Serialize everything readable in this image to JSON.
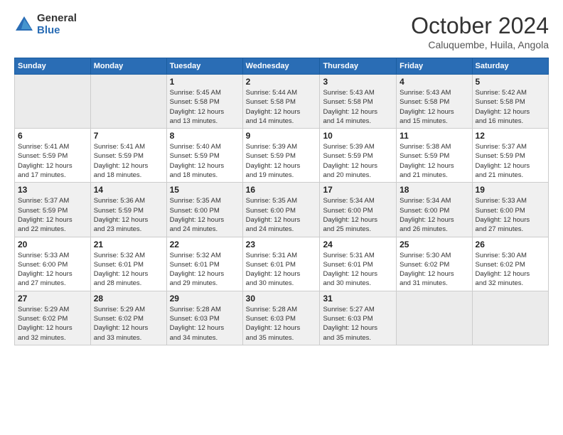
{
  "logo": {
    "general": "General",
    "blue": "Blue"
  },
  "title": {
    "month": "October 2024",
    "location": "Caluquembe, Huila, Angola"
  },
  "headers": [
    "Sunday",
    "Monday",
    "Tuesday",
    "Wednesday",
    "Thursday",
    "Friday",
    "Saturday"
  ],
  "weeks": [
    [
      {
        "day": "",
        "info": ""
      },
      {
        "day": "",
        "info": ""
      },
      {
        "day": "1",
        "info": "Sunrise: 5:45 AM\nSunset: 5:58 PM\nDaylight: 12 hours\nand 13 minutes."
      },
      {
        "day": "2",
        "info": "Sunrise: 5:44 AM\nSunset: 5:58 PM\nDaylight: 12 hours\nand 14 minutes."
      },
      {
        "day": "3",
        "info": "Sunrise: 5:43 AM\nSunset: 5:58 PM\nDaylight: 12 hours\nand 14 minutes."
      },
      {
        "day": "4",
        "info": "Sunrise: 5:43 AM\nSunset: 5:58 PM\nDaylight: 12 hours\nand 15 minutes."
      },
      {
        "day": "5",
        "info": "Sunrise: 5:42 AM\nSunset: 5:58 PM\nDaylight: 12 hours\nand 16 minutes."
      }
    ],
    [
      {
        "day": "6",
        "info": "Sunrise: 5:41 AM\nSunset: 5:59 PM\nDaylight: 12 hours\nand 17 minutes."
      },
      {
        "day": "7",
        "info": "Sunrise: 5:41 AM\nSunset: 5:59 PM\nDaylight: 12 hours\nand 18 minutes."
      },
      {
        "day": "8",
        "info": "Sunrise: 5:40 AM\nSunset: 5:59 PM\nDaylight: 12 hours\nand 18 minutes."
      },
      {
        "day": "9",
        "info": "Sunrise: 5:39 AM\nSunset: 5:59 PM\nDaylight: 12 hours\nand 19 minutes."
      },
      {
        "day": "10",
        "info": "Sunrise: 5:39 AM\nSunset: 5:59 PM\nDaylight: 12 hours\nand 20 minutes."
      },
      {
        "day": "11",
        "info": "Sunrise: 5:38 AM\nSunset: 5:59 PM\nDaylight: 12 hours\nand 21 minutes."
      },
      {
        "day": "12",
        "info": "Sunrise: 5:37 AM\nSunset: 5:59 PM\nDaylight: 12 hours\nand 21 minutes."
      }
    ],
    [
      {
        "day": "13",
        "info": "Sunrise: 5:37 AM\nSunset: 5:59 PM\nDaylight: 12 hours\nand 22 minutes."
      },
      {
        "day": "14",
        "info": "Sunrise: 5:36 AM\nSunset: 5:59 PM\nDaylight: 12 hours\nand 23 minutes."
      },
      {
        "day": "15",
        "info": "Sunrise: 5:35 AM\nSunset: 6:00 PM\nDaylight: 12 hours\nand 24 minutes."
      },
      {
        "day": "16",
        "info": "Sunrise: 5:35 AM\nSunset: 6:00 PM\nDaylight: 12 hours\nand 24 minutes."
      },
      {
        "day": "17",
        "info": "Sunrise: 5:34 AM\nSunset: 6:00 PM\nDaylight: 12 hours\nand 25 minutes."
      },
      {
        "day": "18",
        "info": "Sunrise: 5:34 AM\nSunset: 6:00 PM\nDaylight: 12 hours\nand 26 minutes."
      },
      {
        "day": "19",
        "info": "Sunrise: 5:33 AM\nSunset: 6:00 PM\nDaylight: 12 hours\nand 27 minutes."
      }
    ],
    [
      {
        "day": "20",
        "info": "Sunrise: 5:33 AM\nSunset: 6:00 PM\nDaylight: 12 hours\nand 27 minutes."
      },
      {
        "day": "21",
        "info": "Sunrise: 5:32 AM\nSunset: 6:01 PM\nDaylight: 12 hours\nand 28 minutes."
      },
      {
        "day": "22",
        "info": "Sunrise: 5:32 AM\nSunset: 6:01 PM\nDaylight: 12 hours\nand 29 minutes."
      },
      {
        "day": "23",
        "info": "Sunrise: 5:31 AM\nSunset: 6:01 PM\nDaylight: 12 hours\nand 30 minutes."
      },
      {
        "day": "24",
        "info": "Sunrise: 5:31 AM\nSunset: 6:01 PM\nDaylight: 12 hours\nand 30 minutes."
      },
      {
        "day": "25",
        "info": "Sunrise: 5:30 AM\nSunset: 6:02 PM\nDaylight: 12 hours\nand 31 minutes."
      },
      {
        "day": "26",
        "info": "Sunrise: 5:30 AM\nSunset: 6:02 PM\nDaylight: 12 hours\nand 32 minutes."
      }
    ],
    [
      {
        "day": "27",
        "info": "Sunrise: 5:29 AM\nSunset: 6:02 PM\nDaylight: 12 hours\nand 32 minutes."
      },
      {
        "day": "28",
        "info": "Sunrise: 5:29 AM\nSunset: 6:02 PM\nDaylight: 12 hours\nand 33 minutes."
      },
      {
        "day": "29",
        "info": "Sunrise: 5:28 AM\nSunset: 6:03 PM\nDaylight: 12 hours\nand 34 minutes."
      },
      {
        "day": "30",
        "info": "Sunrise: 5:28 AM\nSunset: 6:03 PM\nDaylight: 12 hours\nand 35 minutes."
      },
      {
        "day": "31",
        "info": "Sunrise: 5:27 AM\nSunset: 6:03 PM\nDaylight: 12 hours\nand 35 minutes."
      },
      {
        "day": "",
        "info": ""
      },
      {
        "day": "",
        "info": ""
      }
    ]
  ]
}
